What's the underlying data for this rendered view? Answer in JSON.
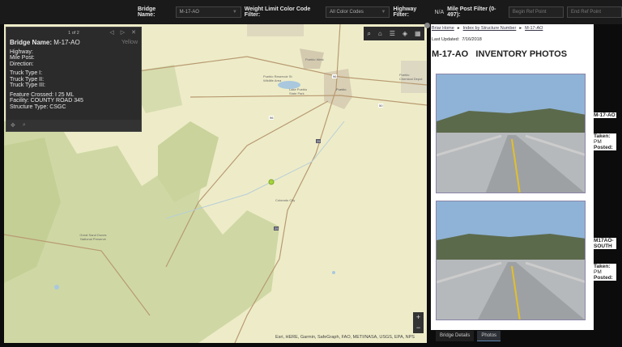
{
  "filters": {
    "bridge_name_label": "Bridge Name:",
    "bridge_name_value": "M-17-AO",
    "weight_label": "Weight Limit Color Code Filter:",
    "weight_value": "All Color Codes",
    "highway_label": "Highway Filter:",
    "highway_value": "N/A",
    "milepost_label": "Mile Post Filter (0-497):",
    "begin_placeholder": "Begin Ref Point",
    "end_placeholder": "End Ref Point"
  },
  "popup": {
    "pager": "1 of 2",
    "title_label": "Bridge Name:",
    "title_value": "M-17-AO",
    "color_code": "Yellow",
    "lines_a": [
      "Highway:",
      "Mile Post:",
      "Direction:"
    ],
    "lines_b": [
      "Truck Type I:",
      "Truck Type II:",
      "Truck Type III:"
    ],
    "lines_c": [
      "Feature Crossed: I 25 ML",
      "Facility: COUNTY ROAD 345",
      "Structure Type: CSGC"
    ]
  },
  "map": {
    "labels": [
      "Pueblo West",
      "Pueblo Reservoir St Wildlife Area",
      "Lake Pueblo State Park",
      "Pueblo",
      "Pueblo Chemical Depot",
      "Colorado City",
      "Great Sand Dunes National Preserve"
    ],
    "shields": [
      "96",
      "50",
      "25",
      "96",
      "25"
    ],
    "attribution": "Esri, HERE, Garmin, SafeGraph, FAO, METI/NASA, USGS, EPA, NPS",
    "zoom_in": "+",
    "zoom_out": "−"
  },
  "panel": {
    "breadcrumbs": [
      "Briar Home",
      "Index by Structure Number",
      "M-17-AO"
    ],
    "updated_label": "Last Updated:",
    "updated_value": "7/16/2018",
    "heading": "M-17-AO   INVENTORY PHOTOS",
    "photos": [
      {
        "caption": "M-17-AO",
        "taken": "Taken:",
        "pm": "PM",
        "posted": "Posted:"
      },
      {
        "caption": "M17AO-SOUTH",
        "taken": "Taken:",
        "pm": "PM",
        "posted": "Posted:"
      }
    ]
  },
  "tabs": [
    "Bridge Details",
    "Photos"
  ]
}
